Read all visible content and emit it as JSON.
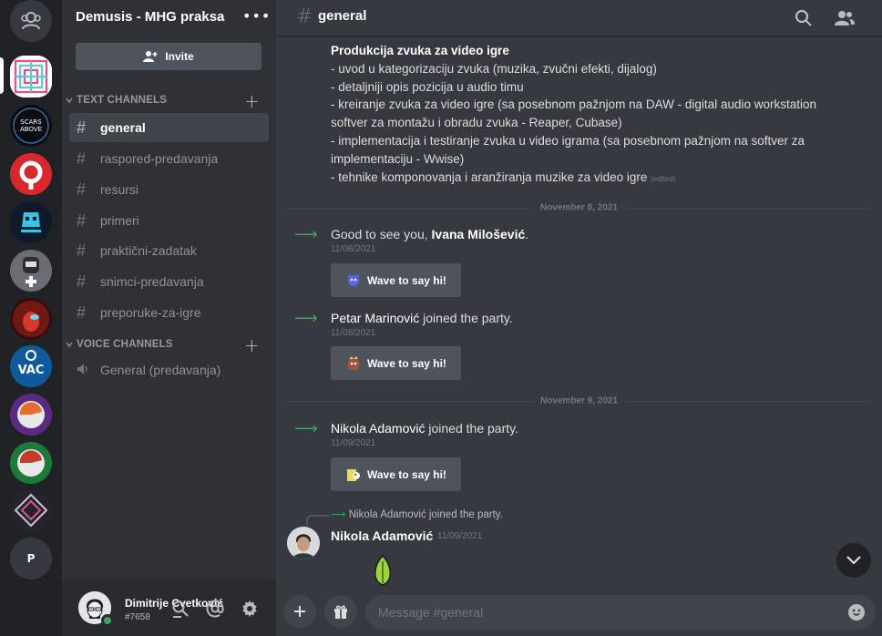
{
  "server_rail": {
    "bottom_server_initial": "P"
  },
  "guild": {
    "name": "Demusis - MHG praksa",
    "more": "•••",
    "invite_label": "Invite"
  },
  "categories": {
    "text": "TEXT CHANNELS",
    "voice": "VOICE CHANNELS"
  },
  "text_channels": [
    {
      "name": "general",
      "active": true
    },
    {
      "name": "raspored-predavanja"
    },
    {
      "name": "resursi"
    },
    {
      "name": "primeri",
      "locked": true
    },
    {
      "name": "praktični-zadatak"
    },
    {
      "name": "snimci-predavanja"
    },
    {
      "name": "preporuke-za-igre"
    }
  ],
  "voice_channels": [
    {
      "name": "General (predavanja)"
    }
  ],
  "user": {
    "name": "Dimitrije Cvetković",
    "tag": "#7658"
  },
  "header": {
    "channel": "general"
  },
  "pinned_message": {
    "heading": "Produkcija zvuka za video igre",
    "lines": [
      "- uvod u kategorizaciju zvuka (muzika, zvučni efekti, dijalog)",
      "- detaljniji opis pozicija u audio timu",
      "- kreiranje zvuka za video igre (sa posebnom pažnjom na DAW - digital audio workstation",
      "softver za montažu i obradu zvuka - Reaper, Cubase)",
      "- implementacija i testiranje zvuka u video igrama (sa posebnom pažnjom na softver za",
      "implementaciju - Wwise)",
      "- tehnike komponovanja i aranžiranja muzike za video igre"
    ],
    "edited": "(edited)"
  },
  "dividers": [
    "November 8, 2021",
    "November 9, 2021"
  ],
  "joins": [
    {
      "prefix": "Good to see you, ",
      "name": "Ivana Milošević",
      "suffix": ".",
      "timestamp": "11/08/2021",
      "wave": "Wave to say hi!"
    },
    {
      "prefix": "",
      "name": "Petar Marinović",
      "suffix": " joined the party.",
      "timestamp": "11/08/2021",
      "wave": "Wave to say hi!"
    },
    {
      "prefix": "",
      "name": "Nikola Adamović",
      "suffix": " joined the party.",
      "timestamp": "11/09/2021",
      "wave": "Wave to say hi!"
    }
  ],
  "reply": {
    "reference": "Nikola Adamović joined the party.",
    "author": "Nikola Adamović",
    "timestamp": "11/09/2021"
  },
  "composer": {
    "placeholder": "Message #general"
  },
  "colors": {
    "rail": "#202225",
    "sidebar": "#2f3136",
    "main": "#36393f",
    "green": "#3ba55d"
  }
}
